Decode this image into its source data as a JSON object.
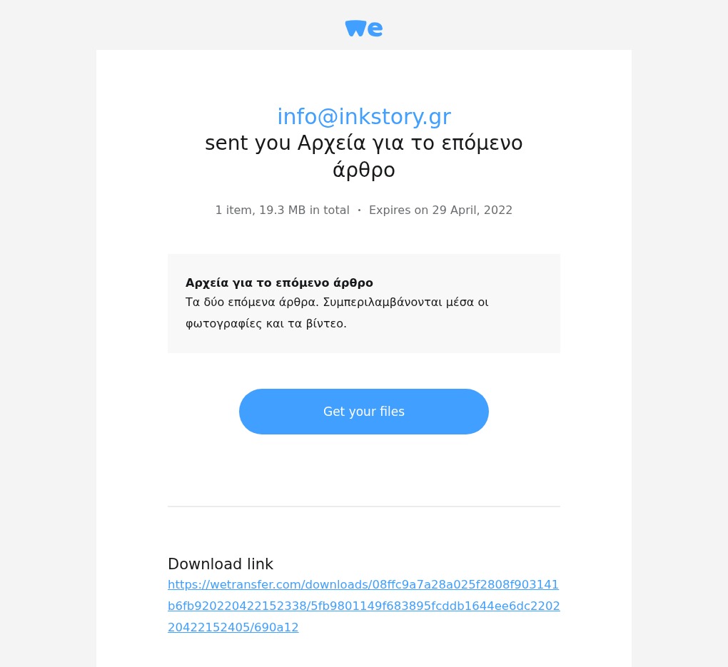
{
  "sender": "info@inkstory.gr",
  "subject": "sent you Αρχεία για το επόμενο άρθρο",
  "meta": [
    "1 item, 19.3 MB in total",
    "Expires on 29 April, 2022"
  ],
  "message": {
    "title": "Αρχεία για το επόμενο άρθρο",
    "body": "Τα δύο επόμενα άρθρα. Συμπεριλαμβάνονται μέσα οι φωτογραφίες και τα βίντεο."
  },
  "button": "Get your files",
  "download": {
    "heading": "Download link",
    "url": "https://wetransfer.com/downloads/08ffc9a7a28a025f2808f903141b6fb920220422152338/5fb9801149f683895fcddb1644ee6dc220220422152405/690a12"
  }
}
